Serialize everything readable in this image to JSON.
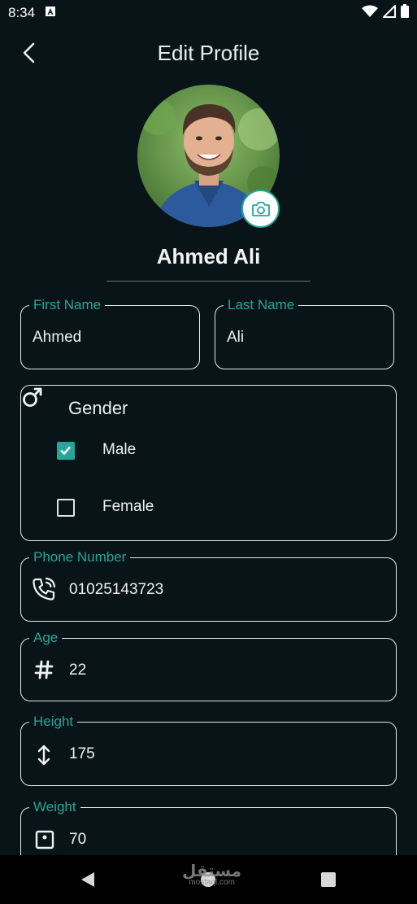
{
  "status_bar": {
    "time": "8:34"
  },
  "header": {
    "title": "Edit Profile"
  },
  "profile": {
    "name": "Ahmed Ali"
  },
  "fields": {
    "first_name": {
      "label": "First Name",
      "value": "Ahmed"
    },
    "last_name": {
      "label": "Last Name",
      "value": "Ali"
    },
    "phone": {
      "label": "Phone Number",
      "value": "01025143723"
    },
    "age": {
      "label": "Age",
      "value": "22"
    },
    "height": {
      "label": "Height",
      "value": "175"
    },
    "weight": {
      "label": "Weight",
      "value": "70"
    }
  },
  "gender": {
    "title": "Gender",
    "options": [
      {
        "label": "Male",
        "checked": true
      },
      {
        "label": "Female",
        "checked": false
      }
    ]
  },
  "watermark": {
    "text": "مستقل",
    "sub": "mostaql.com"
  },
  "colors": {
    "accent": "#26a69a",
    "background": "#081418",
    "border": "#e6ecee"
  },
  "icons": [
    "back-arrow-icon",
    "camera-icon",
    "male-icon",
    "phone-icon",
    "hash-icon",
    "vertical-arrows-icon",
    "scale-icon"
  ]
}
